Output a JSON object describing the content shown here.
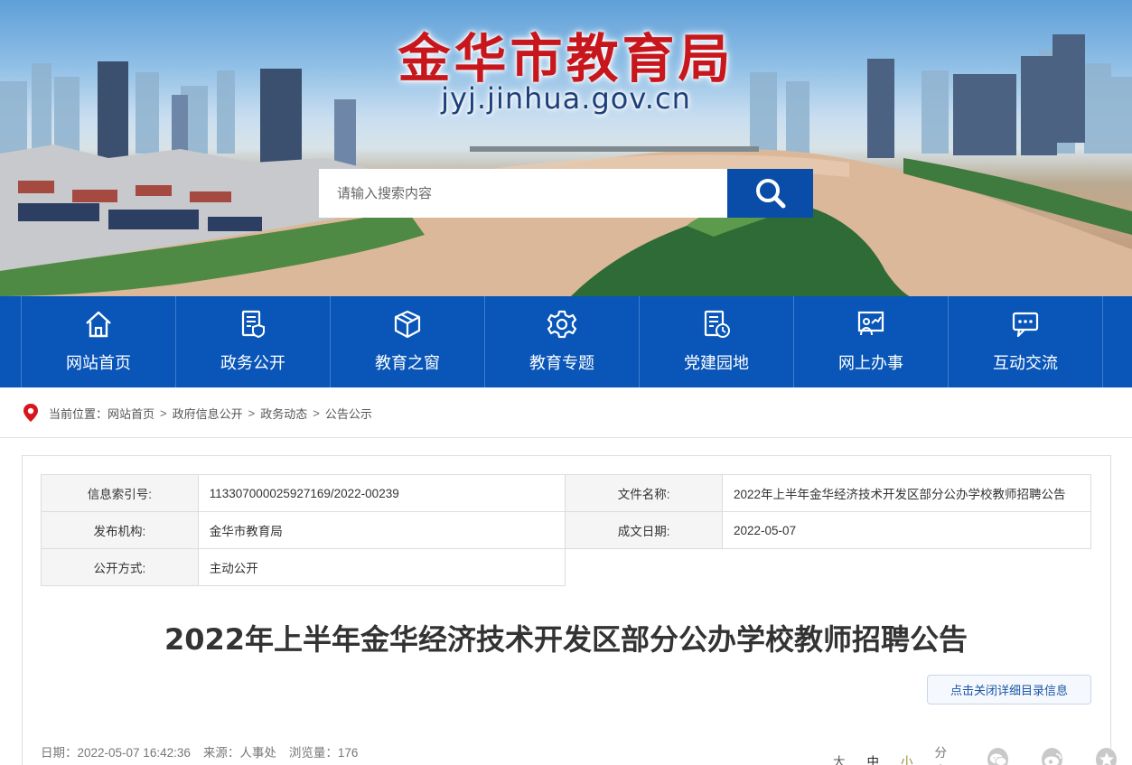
{
  "header": {
    "site_title": "金华市教育局",
    "site_domain": "jyj.jinhua.gov.cn",
    "search": {
      "placeholder": "请输入搜索内容",
      "button_icon": "search-icon"
    }
  },
  "nav": {
    "items": [
      {
        "label": "网站首页",
        "icon": "home-icon"
      },
      {
        "label": "政务公开",
        "icon": "document-shield-icon"
      },
      {
        "label": "教育之窗",
        "icon": "box-icon"
      },
      {
        "label": "教育专题",
        "icon": "gear-icon"
      },
      {
        "label": "党建园地",
        "icon": "document-clock-icon"
      },
      {
        "label": "网上办事",
        "icon": "user-chart-icon"
      },
      {
        "label": "互动交流",
        "icon": "chat-icon"
      }
    ],
    "colors": {
      "background": "#0956b8"
    }
  },
  "breadcrumb": {
    "prefix": "当前位置：",
    "items": [
      "网站首页",
      "政府信息公开",
      "政务动态",
      "公告公示"
    ],
    "separator": ">"
  },
  "meta": {
    "index_no_label": "信息索引号:",
    "index_no_value": "113307000025927169/2022-00239",
    "file_name_label": "文件名称:",
    "file_name_value": "2022年上半年金华经济技术开发区部分公办学校教师招聘公告",
    "publisher_label": "发布机构:",
    "publisher_value": "金华市教育局",
    "date_label": "成文日期:",
    "date_value": "2022-05-07",
    "disclosure_label": "公开方式:",
    "disclosure_value": "主动公开"
  },
  "article": {
    "title": "2022年上半年金华经济技术开发区部分公办学校教师招聘公告",
    "toggle_label": "点击关闭详细目录信息",
    "date_label": "日期：",
    "date_value": "2022-05-07 16:42:36",
    "source_label": "来源：",
    "source_value": "人事处",
    "views_label": "浏览量：",
    "views_value": "176",
    "font_sizes": [
      "大",
      "中",
      "小"
    ],
    "share_label": "分享：",
    "share_icons": [
      "wechat-icon",
      "weibo-icon",
      "star-icon"
    ]
  }
}
